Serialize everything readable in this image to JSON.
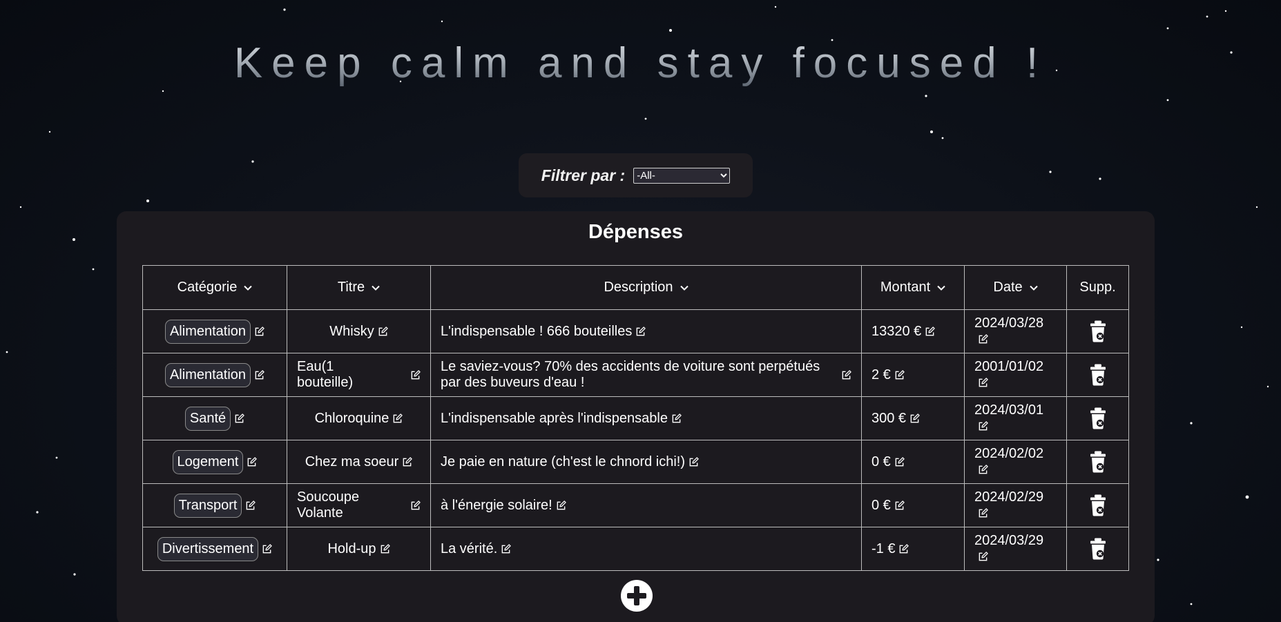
{
  "headline": "Keep calm and stay focused !",
  "filter": {
    "label": "Filtrer par :",
    "selected": "-All-"
  },
  "table": {
    "title": "Dépenses",
    "headers": {
      "category": "Catégorie",
      "title": "Titre",
      "description": "Description",
      "amount": "Montant",
      "date": "Date",
      "delete": "Supp."
    },
    "rows": [
      {
        "category": "Alimentation",
        "title": "Whisky",
        "description": "L'indispensable ! 666 bouteilles",
        "amount": "13320 €",
        "date": "2024/03/28"
      },
      {
        "category": "Alimentation",
        "title": "Eau(1 bouteille)",
        "description": "Le saviez-vous? 70% des accidents de voiture sont perpétués par des buveurs d'eau !",
        "amount": "2 €",
        "date": "2001/01/02"
      },
      {
        "category": "Santé",
        "title": "Chloroquine",
        "description": "L'indispensable après l'indispensable",
        "amount": "300 €",
        "date": "2024/03/01"
      },
      {
        "category": "Logement",
        "title": "Chez ma soeur",
        "description": "Je paie en nature (ch'est le chnord ichi!)",
        "amount": "0 €",
        "date": "2024/02/02"
      },
      {
        "category": "Transport",
        "title": "Soucoupe Volante",
        "description": "à l'énergie solaire!",
        "amount": "0 €",
        "date": "2024/02/29"
      },
      {
        "category": "Divertissement",
        "title": "Hold-up",
        "description": "La vérité.",
        "amount": "-1 €",
        "date": "2024/03/29"
      }
    ]
  },
  "icons": {
    "sort": "chevron-down-icon",
    "edit": "edit-icon",
    "delete": "trash-icon",
    "add": "plus-circle-icon"
  },
  "colors": {
    "background": "#0d1119",
    "panel": "#1c1a1f",
    "border": "#bdbdbd",
    "text": "#ffffff"
  }
}
